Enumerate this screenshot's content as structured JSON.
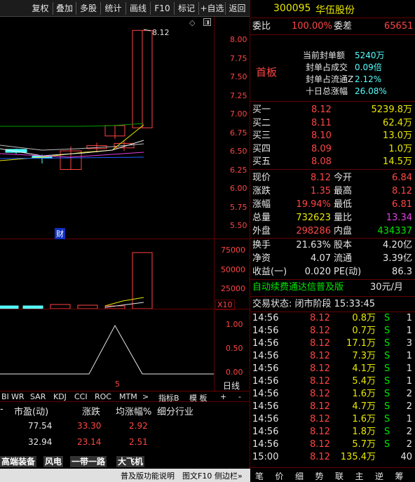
{
  "toolbar": {
    "items": [
      "复权",
      "叠加",
      "多股",
      "统计",
      "画线",
      "F10",
      "标记",
      "+自选",
      "返回"
    ]
  },
  "stock": {
    "code": "300095",
    "name": "华伍股份"
  },
  "kline": {
    "price_label": "8.12",
    "axis": [
      "8.00",
      "7.75",
      "7.50",
      "7.25",
      "7.00",
      "6.75",
      "6.50",
      "6.25",
      "6.00",
      "5.75",
      "5.50"
    ],
    "finance_badge": "财",
    "volume_axis": [
      "75000",
      "50000",
      "25000"
    ],
    "volume_unit": "X10",
    "indicator_axis": [
      "1.00",
      "0.50",
      "0.00"
    ],
    "indicator_marker": "5",
    "candles": [
      {
        "o": 6.52,
        "c": 6.48,
        "h": 6.53,
        "l": 6.46,
        "color": "cyan"
      },
      {
        "o": 6.43,
        "c": 6.4,
        "h": 6.45,
        "l": 6.33,
        "color": "cyan"
      },
      {
        "o": 6.5,
        "c": 6.25,
        "h": 6.56,
        "l": 6.25,
        "color": "red"
      },
      {
        "o": 6.53,
        "c": 6.57,
        "h": 6.61,
        "l": 6.48,
        "color": "red"
      },
      {
        "o": 6.54,
        "c": 6.6,
        "h": 6.63,
        "l": 6.5,
        "color": "red"
      },
      {
        "o": 6.7,
        "c": 6.84,
        "h": 6.84,
        "l": 6.66,
        "color": "red"
      },
      {
        "o": 6.81,
        "c": 8.12,
        "h": 8.12,
        "l": 6.81,
        "color": "red"
      }
    ]
  },
  "bottom_tabs": {
    "items": [
      "BI",
      "WR",
      "SAR",
      "KDJ",
      "CCI",
      "ROC",
      "MTM",
      ">",
      "指标B",
      "模 板",
      "+",
      "-"
    ],
    "label": "日线"
  },
  "table": {
    "headers": [
      "市盈(动)",
      "涨跌",
      "均涨幅%",
      "细分行业"
    ],
    "rows": [
      {
        "pe": "77.54",
        "chg": "33.30",
        "avg": "2.92"
      },
      {
        "pe": "32.94",
        "chg": "23.14",
        "avg": "2.51"
      }
    ]
  },
  "sectors": [
    "高端装备",
    "风电",
    "一带一路",
    "大飞机"
  ],
  "status_bar": {
    "items": [
      "普及版功能说明",
      "图文F10",
      "侧边栏»"
    ]
  },
  "quote": {
    "weibi_label": "委比",
    "weibi": "100.00%",
    "weicha_label": "委差",
    "weicha": "65651",
    "board": "首板",
    "seal_lines": [
      {
        "label": "当前封单额",
        "value": "5240万"
      },
      {
        "label": "封单占成交",
        "value": "0.09倍"
      },
      {
        "label": "封单占流通Z",
        "value": "2.12%"
      },
      {
        "label": "十日总涨幅",
        "value": "26.08%"
      }
    ],
    "bids": [
      {
        "label": "买一",
        "price": "8.12",
        "vol": "5239.8万"
      },
      {
        "label": "买二",
        "price": "8.11",
        "vol": "62.4万"
      },
      {
        "label": "买三",
        "price": "8.10",
        "vol": "13.0万"
      },
      {
        "label": "买四",
        "price": "8.09",
        "vol": "1.0万"
      },
      {
        "label": "买五",
        "price": "8.08",
        "vol": "14.5万"
      }
    ],
    "stats": [
      {
        "l1": "现价",
        "v1": "8.12",
        "l2": "今开",
        "v2": "6.84"
      },
      {
        "l1": "涨跌",
        "v1": "1.35",
        "l2": "最高",
        "v2": "8.12"
      },
      {
        "l1": "涨幅",
        "v1": "19.94%",
        "l2": "最低",
        "v2": "6.81"
      },
      {
        "l1": "总量",
        "v1": "732623",
        "l2": "量比",
        "v2": "13.34"
      },
      {
        "l1": "外盘",
        "v1": "298286",
        "l2": "内盘",
        "v2": "434337"
      }
    ],
    "stats2": [
      {
        "l1": "换手",
        "v1": "21.63%",
        "l2": "股本",
        "v2": "4.20亿"
      },
      {
        "l1": "净资",
        "v1": "4.07",
        "l2": "流通",
        "v2": "3.39亿"
      },
      {
        "l1": "收益(一)",
        "v1": "0.020",
        "l2": "PE(动)",
        "v2": "86.3"
      }
    ],
    "ad_text": "自动续费通达信普及版",
    "ad_price": "30元/月",
    "trade_status": "交易状态: 闭市阶段 15:33:45",
    "ticks": [
      {
        "t": "14:56",
        "p": "8.12",
        "v": "0.8万",
        "s": "S",
        "n": "1"
      },
      {
        "t": "14:56",
        "p": "8.12",
        "v": "0.7万",
        "s": "S",
        "n": "1"
      },
      {
        "t": "14:56",
        "p": "8.12",
        "v": "17.1万",
        "s": "S",
        "n": "3"
      },
      {
        "t": "14:56",
        "p": "8.12",
        "v": "7.3万",
        "s": "S",
        "n": "1"
      },
      {
        "t": "14:56",
        "p": "8.12",
        "v": "4.1万",
        "s": "S",
        "n": "1"
      },
      {
        "t": "14:56",
        "p": "8.12",
        "v": "5.4万",
        "s": "S",
        "n": "1"
      },
      {
        "t": "14:56",
        "p": "8.12",
        "v": "1.6万",
        "s": "S",
        "n": "2"
      },
      {
        "t": "14:56",
        "p": "8.12",
        "v": "4.7万",
        "s": "S",
        "n": "2"
      },
      {
        "t": "14:56",
        "p": "8.12",
        "v": "1.6万",
        "s": "S",
        "n": "1"
      },
      {
        "t": "14:56",
        "p": "8.12",
        "v": "1.8万",
        "s": "S",
        "n": "2"
      },
      {
        "t": "14:56",
        "p": "8.12",
        "v": "5.7万",
        "s": "S",
        "n": "2"
      },
      {
        "t": "15:00",
        "p": "8.12",
        "v": "135.4万",
        "s": "",
        "n": "40"
      }
    ],
    "bottom_tabs": [
      "笔",
      "价",
      "细",
      "势",
      "联",
      "主",
      "逆",
      "筹"
    ]
  }
}
